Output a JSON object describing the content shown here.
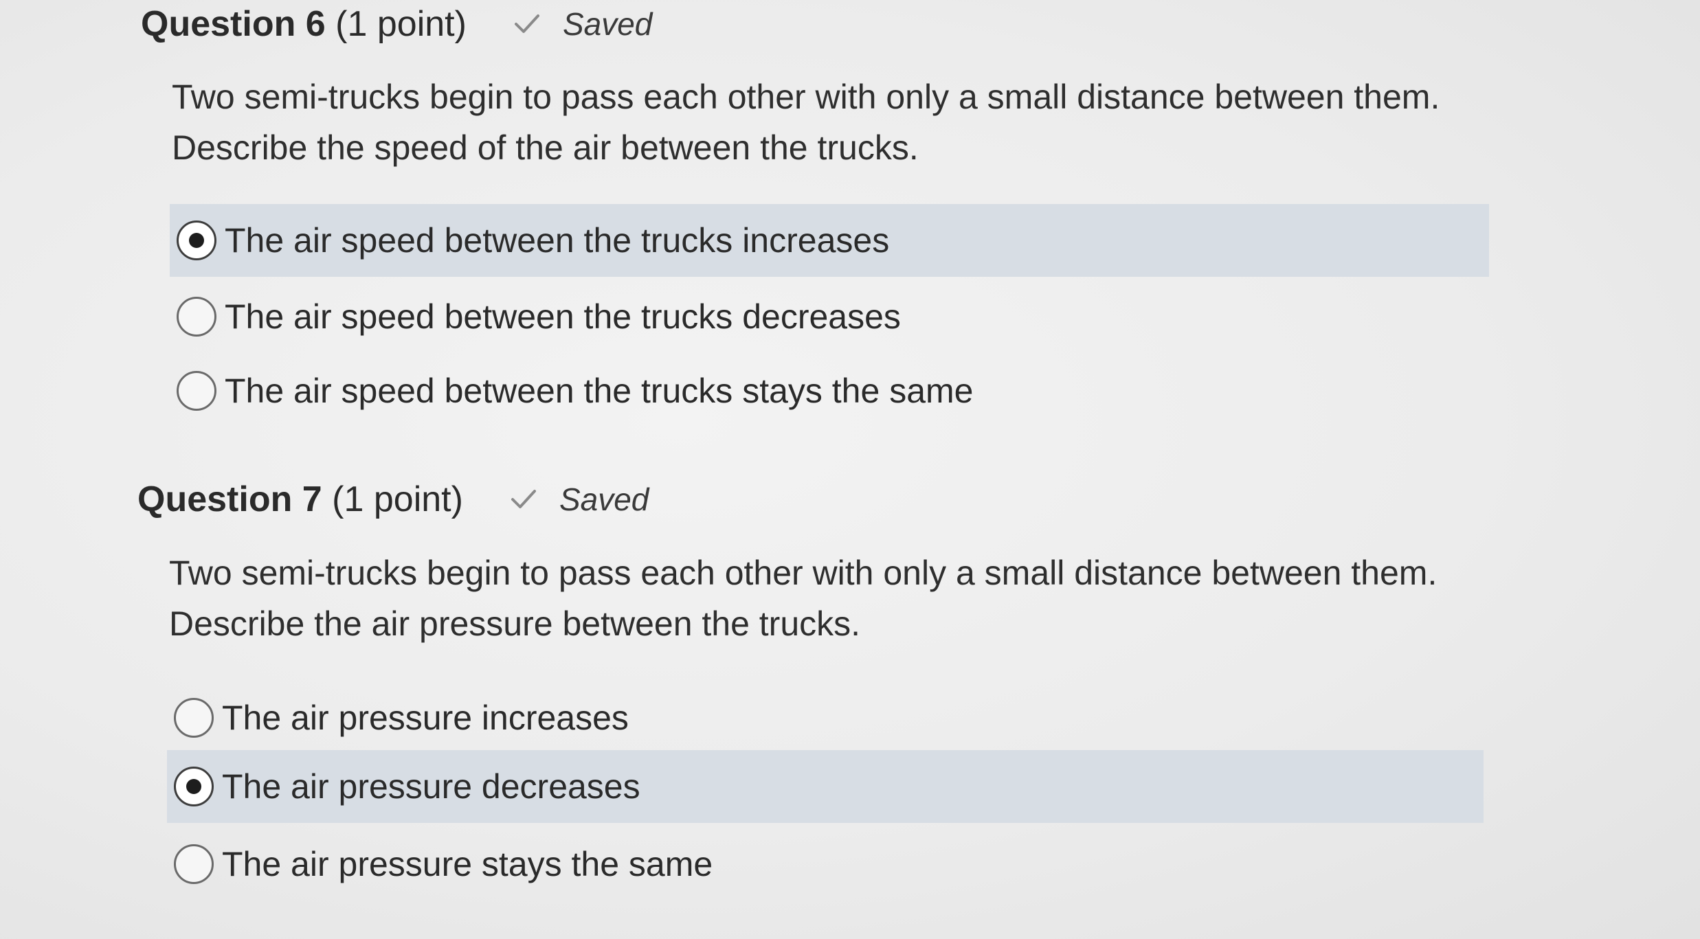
{
  "questions": [
    {
      "number_label": "Question 6",
      "points": "(1 point)",
      "status": "Saved",
      "status_icon": "checkmark-icon",
      "prompt_line1": "Two semi-trucks begin to pass each other with only a small distance between them.",
      "prompt_line2": "Describe the speed of the air between the trucks.",
      "options": [
        {
          "label": "The air speed between the trucks increases",
          "selected": true
        },
        {
          "label": "The air speed between the trucks decreases",
          "selected": false
        },
        {
          "label": "The air speed between the trucks stays the same",
          "selected": false
        }
      ]
    },
    {
      "number_label": "Question 7",
      "points": "(1 point)",
      "status": "Saved",
      "status_icon": "checkmark-icon",
      "prompt_line1": "Two semi-trucks begin to pass each other with only a small distance between them.",
      "prompt_line2": "Describe the air pressure between the trucks.",
      "options": [
        {
          "label": "The air pressure increases",
          "selected": false
        },
        {
          "label": "The air pressure decreases",
          "selected": true
        },
        {
          "label": "The air pressure stays the same",
          "selected": false
        }
      ]
    }
  ],
  "colors": {
    "selected_row_bg": "#d7dde4",
    "page_bg": "#ececec",
    "text": "#2b2b2b"
  }
}
